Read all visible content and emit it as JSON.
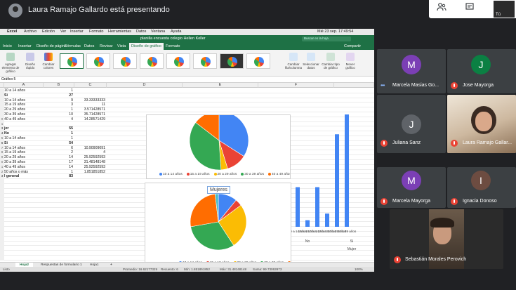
{
  "meeting": {
    "presenter_banner": "Laura Ramajo Gallardo está presentando",
    "self_label": "Tú",
    "icons": [
      "people-icon",
      "chat-icon"
    ]
  },
  "mac_menu": {
    "items": [
      "Excel",
      "Archivo",
      "Edición",
      "Ver",
      "Insertar",
      "Formato",
      "Herramientas",
      "Datos",
      "Ventana",
      "Ayuda"
    ],
    "clock": "Mié 23 sep.  17:49:54"
  },
  "excel": {
    "window_title": "planilla encuesta colegio Hellen Keller",
    "search_placeholder": "Buscar en la hoja",
    "share_label": "Compartir",
    "tabs": [
      "Inicio",
      "Insertar",
      "Diseño de página",
      "Fórmulas",
      "Datos",
      "Revisar",
      "Vista",
      "Diseño de gráfico",
      "Formato"
    ],
    "active_tab": "Diseño de gráfico",
    "ribbon_buttons": [
      {
        "label": "Agregar elemento de gráfico",
        "icon": "add-chart-element-icon"
      },
      {
        "label": "Diseño rápido",
        "icon": "quick-layout-icon"
      },
      {
        "label": "Cambiar colores",
        "icon": "change-colors-icon"
      },
      {
        "label": "Cambiar fila/columna",
        "icon": "switch-row-column-icon"
      },
      {
        "label": "Seleccionar datos",
        "icon": "select-data-icon"
      },
      {
        "label": "Cambiar tipo de gráfico",
        "icon": "change-chart-type-icon"
      },
      {
        "label": "Mover gráfico",
        "icon": "move-chart-icon"
      }
    ],
    "name_box": "Gráfico 5",
    "columns": [
      "A",
      "B",
      "C",
      "D",
      "E",
      "F"
    ],
    "rows": [
      {
        "n": "",
        "a": "10 a 14 años",
        "b": "1",
        "c": "",
        "bold": false
      },
      {
        "n": "",
        "a": "Si",
        "b": "27",
        "c": "",
        "bold": true
      },
      {
        "n": "",
        "a": "10 a 14 años",
        "b": "9",
        "c": "33.33333333",
        "bold": false
      },
      {
        "n": "",
        "a": "15 a 19 años",
        "b": "3",
        "c": "11",
        "bold": false
      },
      {
        "n": "",
        "a": "20 a 29 años",
        "b": "1",
        "c": "3.571428571",
        "bold": false
      },
      {
        "n": "",
        "a": "30 a 39 años",
        "b": "10",
        "c": "35.71428571",
        "bold": false
      },
      {
        "n": "0",
        "a": "40 a 49 años",
        "b": "4",
        "c": "14.28571429",
        "bold": false
      },
      {
        "n": "1",
        "a": "",
        "b": "",
        "c": "",
        "bold": false
      },
      {
        "n": "3",
        "a": "jer",
        "b": "55",
        "c": "",
        "bold": true
      },
      {
        "n": "4",
        "a": "No",
        "b": "1",
        "c": "",
        "bold": true
      },
      {
        "n": "5",
        "a": "10 a 14 años",
        "b": "1",
        "c": "",
        "bold": false
      },
      {
        "n": "6",
        "a": "Si",
        "b": "54",
        "c": "",
        "bold": true
      },
      {
        "n": "7",
        "a": "10 a 14 años",
        "b": "6",
        "c": "10.90909091",
        "bold": false
      },
      {
        "n": "8",
        "a": "15 a 19 años",
        "b": "2",
        "c": "4",
        "bold": false
      },
      {
        "n": "9",
        "a": "20 a 29 años",
        "b": "14",
        "c": "25.92592593",
        "bold": false
      },
      {
        "n": "0",
        "a": "30 a 39 años",
        "b": "17",
        "c": "31.48148148",
        "bold": false
      },
      {
        "n": "1",
        "a": "40 a 49 años",
        "b": "14",
        "c": "25.92592593",
        "bold": false
      },
      {
        "n": "2",
        "a": "50 años o más",
        "b": "1",
        "c": "1.851851852",
        "bold": false
      },
      {
        "n": "3",
        "a": "l general",
        "b": "83",
        "c": "",
        "bold": true
      }
    ],
    "sheet_tabs": [
      "Hoja2",
      "Respuestas de formulario 1",
      "Hoja1"
    ],
    "active_sheet": "Hoja2",
    "status": {
      "left": "Listo",
      "promedio": "Promedio: 16.62177329",
      "recuento": "Recuento: 6",
      "min": "Mín: 1.851851852",
      "max": "Máx: 31.48148148",
      "suma": "Suma: 99.73063973",
      "zoom": "100%"
    }
  },
  "chart_data": [
    {
      "type": "pie",
      "title": "",
      "categories": [
        "10 a 14 años",
        "15 a 19 años",
        "20 a 29 años",
        "30 a 39 años",
        "40 a 49 años"
      ],
      "values": [
        33.33333333,
        11,
        3.571428571,
        35.71428571,
        14.28571429
      ],
      "colors": [
        "#4285f4",
        "#ea4335",
        "#fbbc04",
        "#34a853",
        "#ff6d01"
      ],
      "legend": "bottom"
    },
    {
      "type": "pie",
      "title": "Mujeres",
      "categories": [
        "10 a 14 años",
        "15 a 19 años",
        "20 a 29 años",
        "30 a 39 años",
        "40 a 49 años",
        "50 años o más"
      ],
      "values": [
        10.90909091,
        4,
        25.92592593,
        31.48148148,
        25.92592593,
        1.851851852
      ],
      "colors": [
        "#4285f4",
        "#ea4335",
        "#fbbc04",
        "#34a853",
        "#ff6d01",
        "#46bdc6"
      ],
      "legend": "bottom"
    },
    {
      "type": "bar",
      "title": "",
      "categories": [
        "10 a 14 años",
        "15 a 19 años",
        "10 a 14 años",
        "15 a 19 años",
        "20 a 29 años",
        "30 a 39 años"
      ],
      "groups": [
        "No",
        "Si"
      ],
      "outer_group": "Mujer",
      "values": [
        6,
        1,
        6,
        2,
        14,
        17
      ],
      "ylim": [
        0,
        17
      ],
      "color": "#4285f4"
    }
  ],
  "participants": [
    {
      "name": "Marcela Masias Go...",
      "initial": "M",
      "color": "#7b3fb5",
      "muted": false,
      "video": false
    },
    {
      "name": "Jose Mayorga",
      "initial": "J",
      "color": "#0b8043",
      "muted": true,
      "video": false
    },
    {
      "name": "Juliana Sanz",
      "initial": "J",
      "color": "#5f6368",
      "muted": true,
      "video": false
    },
    {
      "name": "Laura Ramajo Gallar...",
      "initial": "",
      "color": "",
      "muted": true,
      "video": true
    },
    {
      "name": "Marcela Mayorga",
      "initial": "M",
      "color": "#7b3fb5",
      "muted": true,
      "video": false
    },
    {
      "name": "Ignacia Donoso",
      "initial": "I",
      "color": "#6d4c41",
      "muted": true,
      "video": false
    },
    {
      "name": "Sebastián Morales Perovich",
      "initial": "",
      "color": "",
      "muted": true,
      "video": true
    }
  ]
}
